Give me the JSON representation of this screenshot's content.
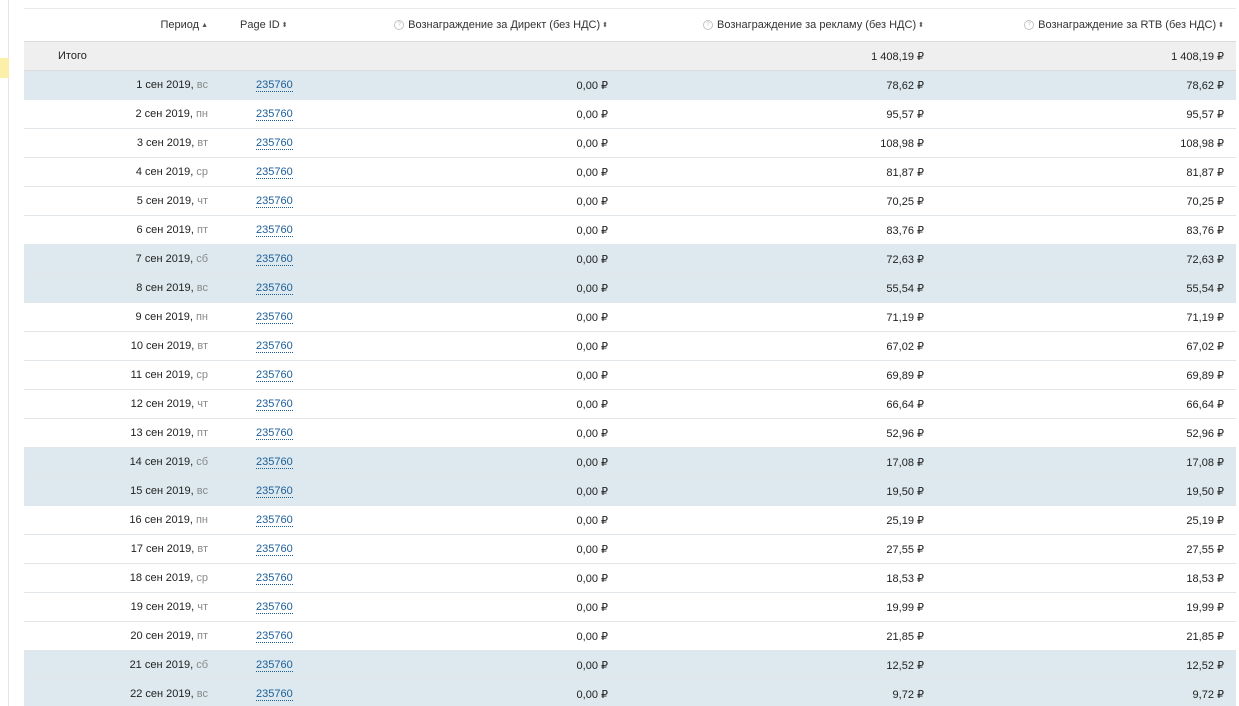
{
  "table": {
    "columns": {
      "period": "Период",
      "page_id": "Page ID",
      "direct": "Вознаграждение за Директ (без НДС)",
      "ads": "Вознаграждение за рекламу (без НДС)",
      "rtb": "Вознаграждение за RTB (без НДС)"
    },
    "sort_icons": {
      "period": "▲",
      "page_id": "⬍",
      "direct": "⬍",
      "ads": "⬍",
      "rtb": "⬍"
    },
    "help_icon": "?",
    "total": {
      "label": "Итого",
      "direct": "",
      "ads": "1 408,19 ₽",
      "rtb": "1 408,19 ₽"
    },
    "rows": [
      {
        "date": "1 сен 2019, ",
        "weekday": "вс",
        "page_id": "235760",
        "direct": "0,00 ₽",
        "ads": "78,62 ₽",
        "rtb": "78,62 ₽",
        "weekend": true
      },
      {
        "date": "2 сен 2019, ",
        "weekday": "пн",
        "page_id": "235760",
        "direct": "0,00 ₽",
        "ads": "95,57 ₽",
        "rtb": "95,57 ₽",
        "weekend": false
      },
      {
        "date": "3 сен 2019, ",
        "weekday": "вт",
        "page_id": "235760",
        "direct": "0,00 ₽",
        "ads": "108,98 ₽",
        "rtb": "108,98 ₽",
        "weekend": false
      },
      {
        "date": "4 сен 2019, ",
        "weekday": "ср",
        "page_id": "235760",
        "direct": "0,00 ₽",
        "ads": "81,87 ₽",
        "rtb": "81,87 ₽",
        "weekend": false
      },
      {
        "date": "5 сен 2019, ",
        "weekday": "чт",
        "page_id": "235760",
        "direct": "0,00 ₽",
        "ads": "70,25 ₽",
        "rtb": "70,25 ₽",
        "weekend": false
      },
      {
        "date": "6 сен 2019, ",
        "weekday": "пт",
        "page_id": "235760",
        "direct": "0,00 ₽",
        "ads": "83,76 ₽",
        "rtb": "83,76 ₽",
        "weekend": false
      },
      {
        "date": "7 сен 2019, ",
        "weekday": "сб",
        "page_id": "235760",
        "direct": "0,00 ₽",
        "ads": "72,63 ₽",
        "rtb": "72,63 ₽",
        "weekend": true
      },
      {
        "date": "8 сен 2019, ",
        "weekday": "вс",
        "page_id": "235760",
        "direct": "0,00 ₽",
        "ads": "55,54 ₽",
        "rtb": "55,54 ₽",
        "weekend": true
      },
      {
        "date": "9 сен 2019, ",
        "weekday": "пн",
        "page_id": "235760",
        "direct": "0,00 ₽",
        "ads": "71,19 ₽",
        "rtb": "71,19 ₽",
        "weekend": false
      },
      {
        "date": "10 сен 2019, ",
        "weekday": "вт",
        "page_id": "235760",
        "direct": "0,00 ₽",
        "ads": "67,02 ₽",
        "rtb": "67,02 ₽",
        "weekend": false
      },
      {
        "date": "11 сен 2019, ",
        "weekday": "ср",
        "page_id": "235760",
        "direct": "0,00 ₽",
        "ads": "69,89 ₽",
        "rtb": "69,89 ₽",
        "weekend": false
      },
      {
        "date": "12 сен 2019, ",
        "weekday": "чт",
        "page_id": "235760",
        "direct": "0,00 ₽",
        "ads": "66,64 ₽",
        "rtb": "66,64 ₽",
        "weekend": false
      },
      {
        "date": "13 сен 2019, ",
        "weekday": "пт",
        "page_id": "235760",
        "direct": "0,00 ₽",
        "ads": "52,96 ₽",
        "rtb": "52,96 ₽",
        "weekend": false
      },
      {
        "date": "14 сен 2019, ",
        "weekday": "сб",
        "page_id": "235760",
        "direct": "0,00 ₽",
        "ads": "17,08 ₽",
        "rtb": "17,08 ₽",
        "weekend": true
      },
      {
        "date": "15 сен 2019, ",
        "weekday": "вс",
        "page_id": "235760",
        "direct": "0,00 ₽",
        "ads": "19,50 ₽",
        "rtb": "19,50 ₽",
        "weekend": true
      },
      {
        "date": "16 сен 2019, ",
        "weekday": "пн",
        "page_id": "235760",
        "direct": "0,00 ₽",
        "ads": "25,19 ₽",
        "rtb": "25,19 ₽",
        "weekend": false
      },
      {
        "date": "17 сен 2019, ",
        "weekday": "вт",
        "page_id": "235760",
        "direct": "0,00 ₽",
        "ads": "27,55 ₽",
        "rtb": "27,55 ₽",
        "weekend": false
      },
      {
        "date": "18 сен 2019, ",
        "weekday": "ср",
        "page_id": "235760",
        "direct": "0,00 ₽",
        "ads": "18,53 ₽",
        "rtb": "18,53 ₽",
        "weekend": false
      },
      {
        "date": "19 сен 2019, ",
        "weekday": "чт",
        "page_id": "235760",
        "direct": "0,00 ₽",
        "ads": "19,99 ₽",
        "rtb": "19,99 ₽",
        "weekend": false
      },
      {
        "date": "20 сен 2019, ",
        "weekday": "пт",
        "page_id": "235760",
        "direct": "0,00 ₽",
        "ads": "21,85 ₽",
        "rtb": "21,85 ₽",
        "weekend": false
      },
      {
        "date": "21 сен 2019, ",
        "weekday": "сб",
        "page_id": "235760",
        "direct": "0,00 ₽",
        "ads": "12,52 ₽",
        "rtb": "12,52 ₽",
        "weekend": true
      },
      {
        "date": "22 сен 2019, ",
        "weekday": "вс",
        "page_id": "235760",
        "direct": "0,00 ₽",
        "ads": "9,72 ₽",
        "rtb": "9,72 ₽",
        "weekend": true
      }
    ]
  },
  "colors": {
    "weekend_row": "#dde9ee",
    "total_row": "#efefef",
    "link": "#1b5e99",
    "left_marker": "#fcefa8"
  }
}
